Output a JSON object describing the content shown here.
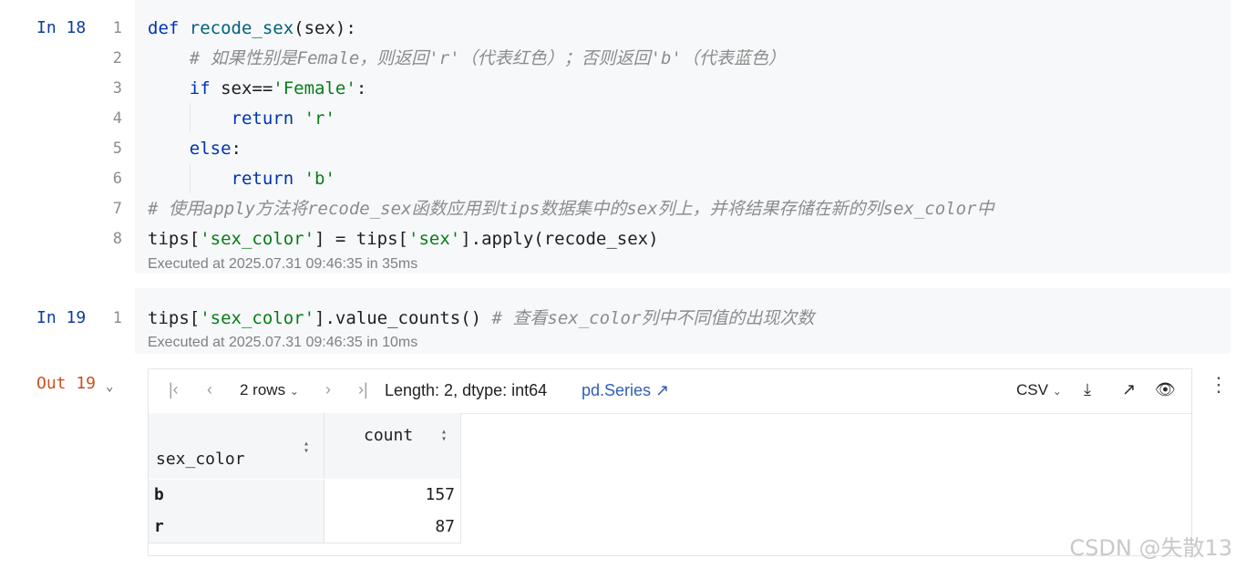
{
  "cells": [
    {
      "prompt": "In 18",
      "lines": [
        {
          "n": "1",
          "parts": [
            {
              "t": "def ",
              "c": "kw"
            },
            {
              "t": "recode_sex",
              "c": "fn"
            },
            {
              "t": "(sex):",
              "c": ""
            }
          ]
        },
        {
          "n": "2",
          "parts": [
            {
              "t": "    # 如果性别是Female，则返回'r'（代表红色）；否则返回'b'（代表蓝色）",
              "c": "cm"
            }
          ]
        },
        {
          "n": "3",
          "parts": [
            {
              "t": "    ",
              "c": ""
            },
            {
              "t": "if ",
              "c": "kw"
            },
            {
              "t": "sex==",
              "c": ""
            },
            {
              "t": "'Female'",
              "c": "str"
            },
            {
              "t": ":",
              "c": ""
            }
          ]
        },
        {
          "n": "4",
          "parts": [
            {
              "t": "        ",
              "c": ""
            },
            {
              "t": "return ",
              "c": "kw"
            },
            {
              "t": "'r'",
              "c": "str"
            }
          ]
        },
        {
          "n": "5",
          "parts": [
            {
              "t": "    ",
              "c": ""
            },
            {
              "t": "else",
              "c": "kw"
            },
            {
              "t": ":",
              "c": ""
            }
          ]
        },
        {
          "n": "6",
          "parts": [
            {
              "t": "        ",
              "c": ""
            },
            {
              "t": "return ",
              "c": "kw"
            },
            {
              "t": "'b'",
              "c": "str"
            }
          ]
        },
        {
          "n": "7",
          "parts": [
            {
              "t": "# 使用apply方法将recode_sex函数应用到tips数据集中的sex列上，并将结果存储在新的列sex_color中",
              "c": "cm"
            }
          ]
        },
        {
          "n": "8",
          "parts": [
            {
              "t": "tips[",
              "c": ""
            },
            {
              "t": "'sex_color'",
              "c": "str"
            },
            {
              "t": "] = tips[",
              "c": ""
            },
            {
              "t": "'sex'",
              "c": "str"
            },
            {
              "t": "].apply(recode_sex)",
              "c": ""
            }
          ]
        }
      ],
      "exec": "Executed at 2025.07.31 09:46:35 in 35ms"
    },
    {
      "prompt": "In 19",
      "lines": [
        {
          "n": "1",
          "parts": [
            {
              "t": "tips[",
              "c": ""
            },
            {
              "t": "'sex_color'",
              "c": "str"
            },
            {
              "t": "].value_counts() ",
              "c": ""
            },
            {
              "t": "# 查看sex_color列中不同值的出现次数",
              "c": "cm"
            }
          ]
        }
      ],
      "exec": "Executed at 2025.07.31 09:46:35 in 10ms"
    }
  ],
  "output": {
    "prompt": "Out 19",
    "rows_label": "2 rows",
    "info": "Length: 2, dtype: int64",
    "type_link": "pd.Series ↗",
    "csv_label": "CSV",
    "index_header": "sex_color",
    "value_header": "count",
    "rows": [
      {
        "index": "b",
        "value": "157"
      },
      {
        "index": "r",
        "value": "87"
      }
    ]
  },
  "watermark": "CSDN @失散13",
  "colors": {
    "keyword": "#0033b3",
    "string": "#067d17",
    "comment": "#8c8c8c",
    "prompt_in": "#0b3c9c",
    "prompt_out": "#c7511f",
    "link": "#2f5fb3"
  }
}
